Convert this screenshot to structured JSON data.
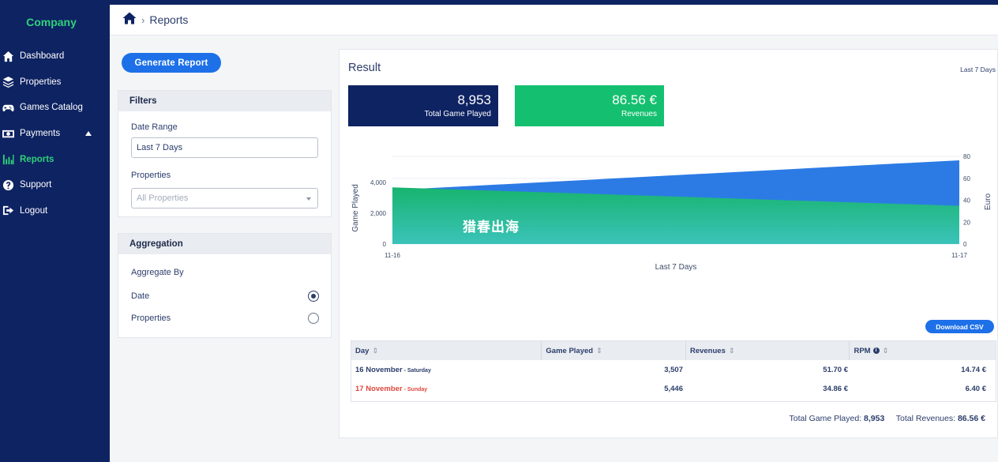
{
  "brand": "Company",
  "nav": [
    {
      "label": "Dashboard",
      "icon": "home-icon"
    },
    {
      "label": "Properties",
      "icon": "layers-icon"
    },
    {
      "label": "Games Catalog",
      "icon": "gamepad-icon"
    },
    {
      "label": "Payments",
      "icon": "money-icon"
    },
    {
      "label": "Reports",
      "icon": "bar-chart-icon",
      "active": true
    },
    {
      "label": "Support",
      "icon": "help-icon"
    },
    {
      "label": "Logout",
      "icon": "logout-icon"
    }
  ],
  "header": {
    "breadcrumb_sep": "›",
    "title": "Reports"
  },
  "generate_button": "Generate Report",
  "filters": {
    "heading": "Filters",
    "date_range_label": "Date Range",
    "date_range_value": "Last 7 Days",
    "properties_label": "Properties",
    "properties_value": "All Properties"
  },
  "aggregation": {
    "heading": "Aggregation",
    "aggregate_by_label": "Aggregate By",
    "options": [
      {
        "label": "Date",
        "checked": true
      },
      {
        "label": "Properties",
        "checked": false
      }
    ]
  },
  "result": {
    "title": "Result",
    "range_link": "Last 7 Days",
    "total_games": {
      "value": "8,953",
      "caption": "Total Game Played"
    },
    "revenues": {
      "value": "86.56 €",
      "caption": "Revenues"
    },
    "download_csv": "Download CSV",
    "table": {
      "headers": [
        "Day",
        "Game Played",
        "Revenues",
        "RPM"
      ],
      "rows": [
        {
          "day": "16 November",
          "weekday": " - Saturday",
          "games": "3,507",
          "revenues": "51.70 €",
          "rpm": "14.74 €",
          "highlight": false
        },
        {
          "day": "17 November",
          "weekday": " - Sunday",
          "games": "5,446",
          "revenues": "34.86 €",
          "rpm": "6.40 €",
          "highlight": true
        }
      ]
    },
    "totals": {
      "games_label": "Total Game Played:",
      "games_value": "8,953",
      "revenues_label": "Total Revenues:",
      "revenues_value": "86.56 €"
    }
  },
  "chart_data": {
    "type": "area",
    "x": [
      "11-16",
      "11-17"
    ],
    "xlabel": "Last 7 Days",
    "ylabel_left": "Game Played",
    "ylabel_right": "Euro",
    "y_left_ticks": [
      "0",
      "2,000",
      "4,000"
    ],
    "y_right_ticks": [
      "0",
      "20",
      "40",
      "60",
      "80"
    ],
    "ylim_left": [
      0,
      5700
    ],
    "ylim_right": [
      0,
      80
    ],
    "series": [
      {
        "axis": "left",
        "values": [
          3507,
          5446
        ],
        "color": "#2c7be5"
      },
      {
        "axis": "right",
        "values": [
          51.7,
          34.86
        ],
        "color": "#18b88e"
      }
    ],
    "grid": true
  },
  "watermark": "猎春出海",
  "colors": {
    "sidebar": "#0e2362",
    "accent_green": "#2ed17a",
    "primary_blue": "#1d70e8",
    "revenue_green": "#14c06f",
    "negative_red": "#e0473d"
  }
}
